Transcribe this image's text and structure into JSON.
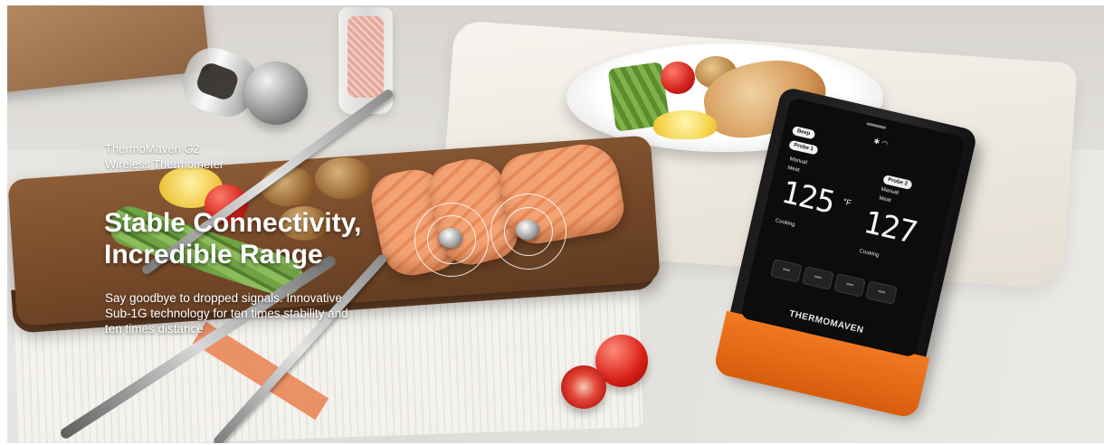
{
  "banner": {
    "eyebrow": {
      "product_name": "ThermoMaven G2",
      "product_type": "Wireless Thermometer"
    },
    "headline": {
      "line1": "Stable Connectivity,",
      "line2": "Incredible Range"
    },
    "body": {
      "line1": "Say goodbye to dropped signals. Innovative",
      "line2": "Sub-1G technology for ten times stability and",
      "line3": "ten times distance"
    }
  },
  "device": {
    "brand": "THERMOMAVEN",
    "screen": {
      "pill_left_top": "Beep",
      "pill_probe1": "Probe 1",
      "pill_probe2": "Probe 2",
      "mode_left": "Manual",
      "mode_right": "Manual",
      "food_left": "Meat",
      "food_right": "Meat",
      "temp_left": "125",
      "temp_right": "127",
      "unit": "°F",
      "status_left": "Cooking",
      "status_right": "Cooking"
    },
    "colors": {
      "body": "#1b1b1b",
      "base": "#f27a22",
      "screen": "#0c0c0c"
    }
  },
  "icons": {
    "bluetooth": "bluetooth-icon",
    "wifi": "wifi-icon",
    "signal_rings": "signal-rings-icon"
  }
}
